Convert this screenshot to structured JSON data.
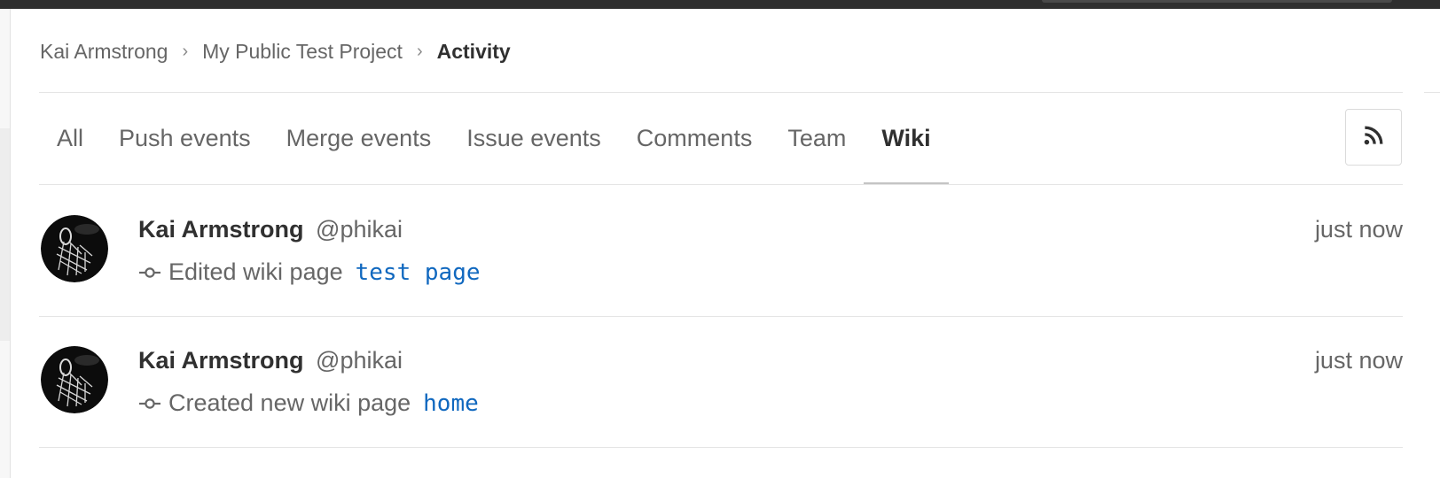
{
  "breadcrumb": {
    "items": [
      "Kai Armstrong",
      "My Public Test Project"
    ],
    "current": "Activity",
    "separator": "›"
  },
  "tabs": [
    {
      "label": "All",
      "active": false
    },
    {
      "label": "Push events",
      "active": false
    },
    {
      "label": "Merge events",
      "active": false
    },
    {
      "label": "Issue events",
      "active": false
    },
    {
      "label": "Comments",
      "active": false
    },
    {
      "label": "Team",
      "active": false
    },
    {
      "label": "Wiki",
      "active": true
    }
  ],
  "rss_button": {
    "icon": "rss-icon"
  },
  "events": [
    {
      "author_name": "Kai Armstrong",
      "author_handle": "@phikai",
      "time": "just now",
      "action": "Edited wiki page",
      "target": "test page",
      "icon": "commit-icon"
    },
    {
      "author_name": "Kai Armstrong",
      "author_handle": "@phikai",
      "time": "just now",
      "action": "Created new wiki page",
      "target": "home",
      "icon": "commit-icon"
    }
  ],
  "colors": {
    "link": "#1068bf",
    "text_primary": "#303030",
    "text_secondary": "#666666",
    "border": "#e5e5e5",
    "active_tab_underline": "#c4c4c4",
    "topbar": "#2f2f2f"
  }
}
